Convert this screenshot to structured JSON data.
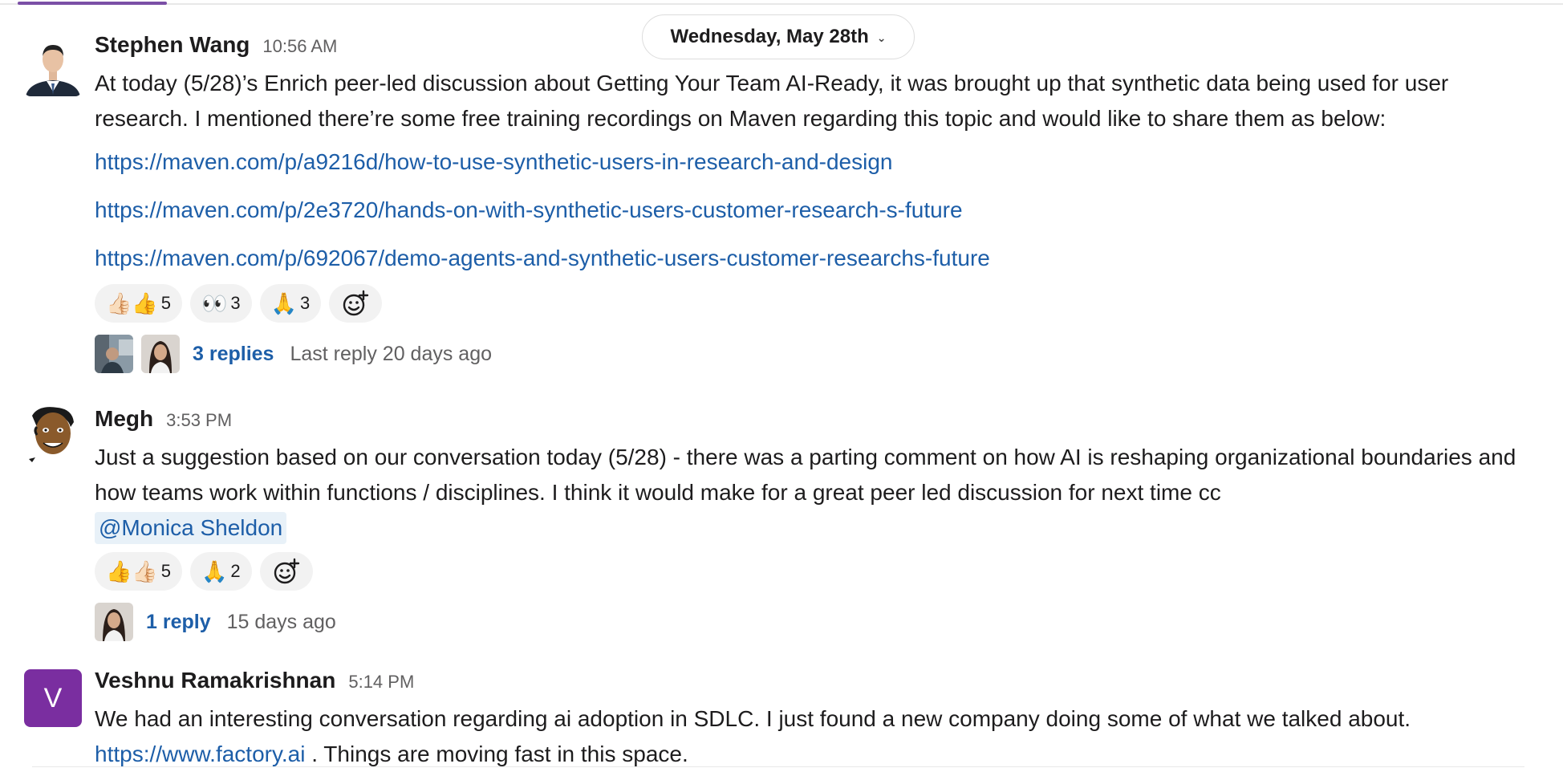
{
  "date_divider": {
    "label": "Wednesday, May 28th",
    "chevron_icon": "chevron-down-icon"
  },
  "messages": [
    {
      "author": "Stephen Wang",
      "time": "10:56 AM",
      "text": "At today (5/28)’s Enrich peer-led discussion about Getting Your Team AI-Ready, it was brought up that synthetic data being used for user research. I mentioned there’re some free training recordings on Maven regarding this topic and would like to share them as below:",
      "links": [
        "https://maven.com/p/a9216d/how-to-use-synthetic-users-in-research-and-design",
        "https://maven.com/p/2e3720/hands-on-with-synthetic-users-customer-research-s-future",
        "https://maven.com/p/692067/demo-agents-and-synthetic-users-customer-researchs-future"
      ],
      "reactions": [
        {
          "emoji": "👍🏻👍",
          "count": "5"
        },
        {
          "emoji": "👀",
          "count": "3"
        },
        {
          "emoji": "🙏",
          "count": "3"
        }
      ],
      "replies": {
        "count_label": "3 replies",
        "last_reply": "Last reply 20 days ago"
      }
    },
    {
      "author": "Megh",
      "time": "3:53 PM",
      "text": "Just a suggestion based on our conversation today (5/28) - there was a parting comment on how AI is reshaping organizational boundaries and how teams work within functions / disciplines. I think it would make for a great peer led discussion for next time cc",
      "mention": "@Monica Sheldon",
      "reactions": [
        {
          "emoji": "👍👍🏻",
          "count": "5"
        },
        {
          "emoji": "🙏",
          "count": "2"
        }
      ],
      "replies": {
        "count_label": "1 reply",
        "last_reply": "15 days ago"
      }
    },
    {
      "author": "Veshnu Ramakrishnan",
      "avatar_letter": "V",
      "avatar_color": "#7a2ea0",
      "time": "5:14 PM",
      "text": "We had an interesting conversation regarding ai adoption in SDLC. I just found a new company doing some of what we talked about.",
      "link": "https://www.factory.ai",
      "text_after": " . Things are moving fast in this space."
    }
  ],
  "colors": {
    "link": "#1d5ea8",
    "accent": "#7b4fa6"
  }
}
